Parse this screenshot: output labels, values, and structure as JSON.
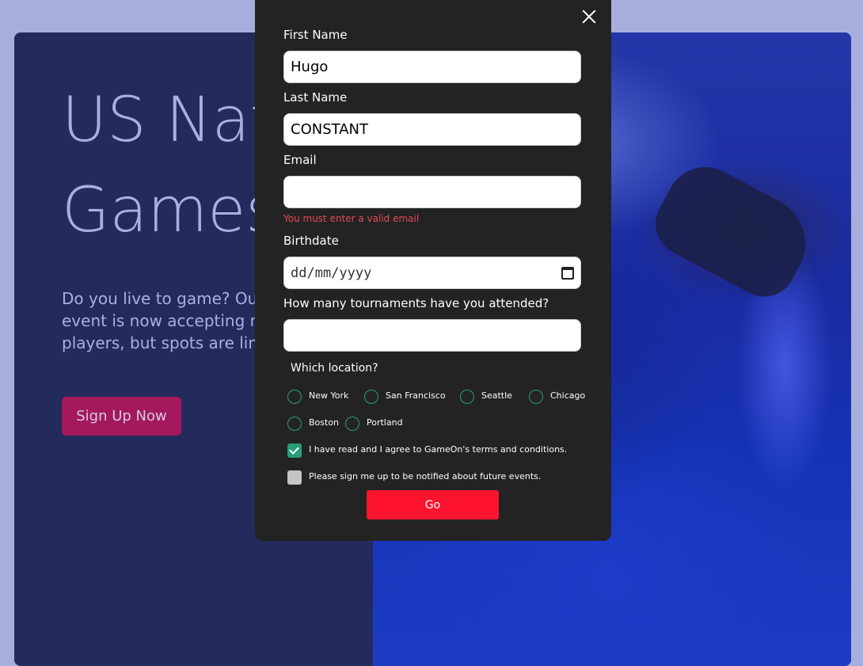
{
  "hero": {
    "title": "US National Games",
    "title_line1": "US National",
    "title_line2": "Games",
    "description": "Do you live to game? Our event is now accepting registrations for players, but spots are limited!",
    "desc_line1": "Do you live to game? Our",
    "desc_line2": "event is now accepting re",
    "desc_line3": "players, but spots are lim",
    "signup_label": "Sign Up Now"
  },
  "form": {
    "first_name": {
      "label": "First Name",
      "value": "Hugo"
    },
    "last_name": {
      "label": "Last Name",
      "value": "CONSTANT"
    },
    "email": {
      "label": "Email",
      "value": "",
      "error": "You must enter a valid email"
    },
    "birthdate": {
      "label": "Birthdate",
      "placeholder": "dd/mm/yyyy"
    },
    "tournaments": {
      "label": "How many tournaments have you attended?",
      "value": ""
    },
    "location": {
      "label": "Which location?",
      "options": [
        "New York",
        "San Francisco",
        "Seattle",
        "Chicago",
        "Boston",
        "Portland"
      ]
    },
    "terms": {
      "label": "I have read and I agree to GameOn's terms and conditions.",
      "checked": true
    },
    "notify": {
      "label": "Please sign me up to be notified about future events.",
      "checked": false
    },
    "submit_label": "Go"
  },
  "colors": {
    "page_bg": "#a8aedc",
    "hero_bg": "#232a5c",
    "modal_bg": "#232323",
    "accent_green": "#279e7a",
    "error_red": "#e54858",
    "submit_red": "#fe142f",
    "signup_bg": "#a3195b"
  }
}
